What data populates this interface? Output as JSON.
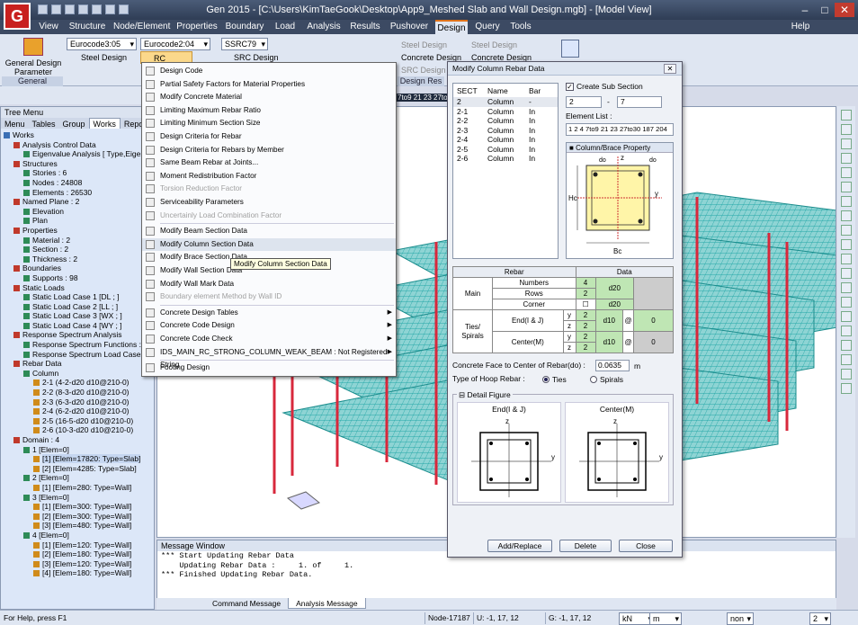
{
  "titlebar": {
    "title": "Gen 2015 - [C:\\Users\\KimTaeGook\\Desktop\\App9_Meshed Slab and Wall Design.mgb] - [Model View]",
    "help": "Help"
  },
  "menu_tabs": [
    "View",
    "Structure",
    "Node/Element",
    "Properties",
    "Boundary",
    "Load",
    "Analysis",
    "Results",
    "Pushover",
    "Design",
    "Query",
    "Tools"
  ],
  "ribbon": {
    "general_design_param": "General Design Parameter",
    "general_group": "General",
    "steel_code": "Eurocode3:05",
    "steel_design": "Steel Design",
    "rc_code": "Eurocode2:04",
    "rc_design": "RC Design",
    "src_code": "SSRC79",
    "src_design": "SRC Design",
    "steel_design2": "Steel Design",
    "concrete_design": "Concrete Design",
    "src_design2": "SRC Design",
    "design_res": "Design Res",
    "steel_design3": "Steel Design",
    "concrete_design2": "Concrete Design"
  },
  "selection_text": "7to9 21 23 27to",
  "tree_menu": {
    "title": "Tree Menu",
    "tabs": [
      "Menu",
      "Tables",
      "Group",
      "Works",
      "Report"
    ],
    "items": [
      {
        "level": 0,
        "text": "Works"
      },
      {
        "level": 1,
        "text": "Analysis Control Data"
      },
      {
        "level": 2,
        "text": "Eigenvalue Analysis [ Type,Eigenv"
      },
      {
        "level": 1,
        "text": "Structures"
      },
      {
        "level": 2,
        "text": "Stories : 6"
      },
      {
        "level": 2,
        "text": "Nodes : 24808"
      },
      {
        "level": 2,
        "text": "Elements : 26530"
      },
      {
        "level": 1,
        "text": "Named Plane : 2"
      },
      {
        "level": 2,
        "text": "Elevation"
      },
      {
        "level": 2,
        "text": "Plan"
      },
      {
        "level": 1,
        "text": "Properties"
      },
      {
        "level": 2,
        "text": "Material : 2"
      },
      {
        "level": 2,
        "text": "Section : 2"
      },
      {
        "level": 2,
        "text": "Thickness : 2"
      },
      {
        "level": 1,
        "text": "Boundaries"
      },
      {
        "level": 2,
        "text": "Supports : 98"
      },
      {
        "level": 1,
        "text": "Static Loads"
      },
      {
        "level": 2,
        "text": "Static Load Case 1 [DL ; ]"
      },
      {
        "level": 2,
        "text": "Static Load Case 2 [LL ; ]"
      },
      {
        "level": 2,
        "text": "Static Load Case 3 [WX ; ]"
      },
      {
        "level": 2,
        "text": "Static Load Case 4 [WY ; ]"
      },
      {
        "level": 1,
        "text": "Response Spectrum Analysis"
      },
      {
        "level": 2,
        "text": "Response Spectrum Functions : 1"
      },
      {
        "level": 2,
        "text": "Response Spectrum Load Cases :"
      },
      {
        "level": 1,
        "text": "Rebar Data"
      },
      {
        "level": 2,
        "text": "Column"
      },
      {
        "level": 3,
        "text": "2-1 (4-2-d20 d10@210-0)"
      },
      {
        "level": 3,
        "text": "2-2 (8-3-d20 d10@210-0)"
      },
      {
        "level": 3,
        "text": "2-3 (6-3-d20 d10@210-0)"
      },
      {
        "level": 3,
        "text": "2-4 (6-2-d20 d10@210-0)"
      },
      {
        "level": 3,
        "text": "2-5 (16-5-d20 d10@210-0)"
      },
      {
        "level": 3,
        "text": "2-6 (10-3-d20 d10@210-0)"
      },
      {
        "level": 1,
        "text": "Domain : 4"
      },
      {
        "level": 2,
        "text": "1 [Elem=0]"
      },
      {
        "level": 3,
        "text": "[1] [Elem=17820: Type=Slab]"
      },
      {
        "level": 3,
        "text": "[2] [Elem=4285: Type=Slab]"
      },
      {
        "level": 2,
        "text": "2 [Elem=0]"
      },
      {
        "level": 3,
        "text": "[1] [Elem=280: Type=Wall]"
      },
      {
        "level": 2,
        "text": "3 [Elem=0]"
      },
      {
        "level": 3,
        "text": "[1] [Elem=300: Type=Wall]"
      },
      {
        "level": 3,
        "text": "[2] [Elem=300: Type=Wall]"
      },
      {
        "level": 3,
        "text": "[3] [Elem=480: Type=Wall]"
      },
      {
        "level": 2,
        "text": "4 [Elem=0]"
      },
      {
        "level": 3,
        "text": "[1] [Elem=120: Type=Wall]"
      },
      {
        "level": 3,
        "text": "[2] [Elem=180: Type=Wall]"
      },
      {
        "level": 3,
        "text": "[3] [Elem=120: Type=Wall]"
      },
      {
        "level": 3,
        "text": "[4] [Elem=180: Type=Wall]"
      }
    ]
  },
  "dropdown": {
    "items": [
      {
        "text": "Design Code",
        "disabled": false,
        "submenu": false
      },
      {
        "text": "Partial Safety Factors for Material Properties",
        "disabled": false,
        "submenu": false
      },
      {
        "text": "Modify Concrete Material",
        "disabled": false,
        "submenu": false
      },
      {
        "text": "Limiting Maximum Rebar Ratio",
        "disabled": false,
        "submenu": false
      },
      {
        "text": "Limiting Minimum Section Size",
        "disabled": false,
        "submenu": false
      },
      {
        "text": "Design Criteria for Rebar",
        "disabled": false,
        "submenu": false
      },
      {
        "text": "Design Criteria for Rebars by Member",
        "disabled": false,
        "submenu": false
      },
      {
        "text": "Same Beam Rebar at Joints...",
        "disabled": false,
        "submenu": false
      },
      {
        "text": "Moment Redistribution Factor",
        "disabled": false,
        "submenu": false
      },
      {
        "text": "Torsion Reduction Factor",
        "disabled": true,
        "submenu": false
      },
      {
        "text": "Serviceability Parameters",
        "disabled": false,
        "submenu": false
      },
      {
        "text": "Uncertainly Load Combination Factor",
        "disabled": true,
        "submenu": false
      },
      {
        "text": "Modify Beam Section Data",
        "disabled": false,
        "submenu": false
      },
      {
        "text": "Modify Column Section Data",
        "disabled": false,
        "submenu": false,
        "highlight": true
      },
      {
        "text": "Modify Brace Section Data",
        "disabled": false,
        "submenu": false
      },
      {
        "text": "Modify Wall Section Data",
        "disabled": false,
        "submenu": false
      },
      {
        "text": "Modify Wall Mark Data",
        "disabled": false,
        "submenu": false
      },
      {
        "text": "Boundary element Method by Wall ID",
        "disabled": true,
        "submenu": false
      },
      {
        "text": "Concrete Design Tables",
        "disabled": false,
        "submenu": true
      },
      {
        "text": "Concrete Code Design",
        "disabled": false,
        "submenu": true
      },
      {
        "text": "Concrete Code Check",
        "disabled": false,
        "submenu": true
      },
      {
        "text": "IDS_MAIN_RC_STRONG_COLUMN_WEAK_BEAM : Not Registered String",
        "disabled": false,
        "submenu": true
      },
      {
        "text": "Footing Design",
        "disabled": false,
        "submenu": false
      }
    ],
    "tooltip": "Modify Column Section Data"
  },
  "dialog": {
    "title": "Modify Column Rebar Data",
    "list_headers": [
      "SECT",
      "Name",
      "Bar"
    ],
    "list_rows": [
      {
        "sect": "2",
        "name": "Column",
        "bar": "-"
      },
      {
        "sect": "2-1",
        "name": "Column",
        "bar": "In"
      },
      {
        "sect": "2-2",
        "name": "Column",
        "bar": "In"
      },
      {
        "sect": "2-3",
        "name": "Column",
        "bar": "In"
      },
      {
        "sect": "2-4",
        "name": "Column",
        "bar": "In"
      },
      {
        "sect": "2-5",
        "name": "Column",
        "bar": "In"
      },
      {
        "sect": "2-6",
        "name": "Column",
        "bar": "In"
      }
    ],
    "create_sub_section": "Create Sub Section",
    "sub_from": "2",
    "sub_dash": "-",
    "sub_to": "7",
    "element_list_label": "Element List :",
    "element_list": "1 2 4 7to9 21 23 27to30 187 204",
    "property_title": "Column/Brace Property",
    "fig_labels": {
      "do": "do",
      "hc": "Hc",
      "bc": "Bc",
      "y": "y",
      "z": "z"
    },
    "rebar_table": {
      "head_rebar": "Rebar",
      "head_data": "Data",
      "main": "Main",
      "numbers": "Numbers",
      "numbers_val": "4",
      "rows": "Rows",
      "rows_val": "2",
      "corner": "Corner",
      "main_dia": "d20",
      "corner_dia": "d20",
      "ties": "Ties/\nSpirals",
      "end": "End(I & J)",
      "center": "Center(M)",
      "y": "y",
      "z": "z",
      "end_y": "2",
      "end_z": "2",
      "end_dia": "d10",
      "end_at": "@",
      "end_sp": "0",
      "cen_y": "2",
      "cen_z": "2",
      "cen_dia": "d10",
      "cen_at": "@",
      "cen_sp": "0"
    },
    "cover_label": "Concrete Face to Center of Rebar(do) :",
    "cover_val": "0.0635",
    "cover_unit": "m",
    "hoop_label": "Type of Hoop Rebar :",
    "hoop_ties": "Ties",
    "hoop_spirals": "Spirals",
    "detail_figure": "Detail Figure",
    "detail_end": "End(I & J)",
    "detail_center": "Center(M)",
    "btn_add": "Add/Replace",
    "btn_delete": "Delete",
    "btn_close": "Close"
  },
  "message_window": {
    "title": "Message Window",
    "lines": [
      "*** Start Updating Rebar Data",
      "    Updating Rebar Data :     1. of     1.",
      "*** Finished Updating Rebar Data."
    ],
    "tabs": [
      "Command Message",
      "Analysis Message"
    ]
  },
  "statusbar": {
    "help": "For Help, press F1",
    "node": "Node-17187",
    "u": "U: -1, 17, 12",
    "g": "G: -1, 17, 12",
    "force_unit": "kN",
    "length_unit": "m",
    "none": "non",
    "page": "2"
  },
  "colors": {
    "accent": "#e0731b",
    "mesh": "#1aa3a3",
    "column": "#d8283c",
    "title": "#2f3d55"
  }
}
